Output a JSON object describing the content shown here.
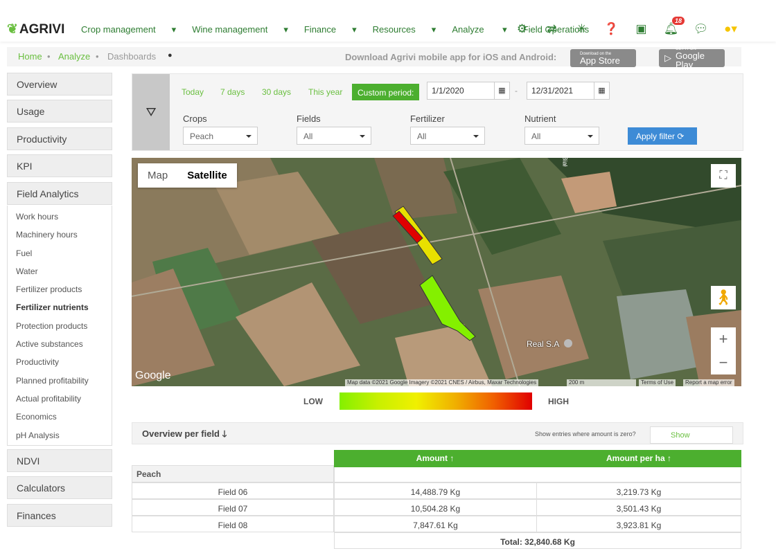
{
  "nav": {
    "brand": "AGRIVI",
    "menu": [
      "Crop management",
      "Wine management",
      "Finance",
      "Resources",
      "Analyze",
      "Field Operations"
    ],
    "notification_count": "18",
    "icons": [
      "gear-icon",
      "transfer-icon",
      "network-icon",
      "help-icon",
      "calendar-icon",
      "bell-icon",
      "chat-icon",
      "user-logo-icon"
    ]
  },
  "breadcrumb": {
    "items": [
      "Home",
      "Analyze",
      "Dashboards"
    ],
    "download_text": "Download Agrivi mobile app for iOS and Android:",
    "app_store": "App Store",
    "app_store_small": "Download on the",
    "google_play": "Google Play",
    "google_play_small": "GET IT ON"
  },
  "sidebar": {
    "sections": [
      "Overview",
      "Usage",
      "Productivity",
      "KPI",
      "Field Analytics"
    ],
    "sub_items": [
      "Work hours",
      "Machinery hours",
      "Fuel",
      "Water",
      "Fertilizer products",
      "Fertilizer nutrients",
      "Protection products",
      "Active substances",
      "Productivity",
      "Planned profitability",
      "Actual profitability",
      "Economics",
      "pH Analysis"
    ],
    "active_sub": "Fertilizer nutrients",
    "bottom": [
      "NDVI",
      "Calculators",
      "Finances"
    ]
  },
  "filter": {
    "periods": [
      "Today",
      "7 days",
      "30 days",
      "This year"
    ],
    "custom": "Custom period:",
    "date_from": "1/1/2020",
    "date_to": "12/31/2021",
    "date_sep": "-",
    "labels": [
      "Crops",
      "Fields",
      "Fertilizer",
      "Nutrient"
    ],
    "values": [
      "Peach",
      "All",
      "All",
      "All"
    ],
    "apply": "Apply filter"
  },
  "map": {
    "tabs": [
      "Map",
      "Satellite"
    ],
    "active_tab": "Satellite",
    "google": "Google",
    "place": "Real S.A",
    "road": "Biał",
    "attribution": "Map data ©2021 Google Imagery ©2021 CNES / Airbus, Maxar Technologies",
    "scale": "200 m",
    "terms": "Terms of Use",
    "report": "Report a map error",
    "zoom_in": "+",
    "zoom_out": "−"
  },
  "legend": {
    "low": "LOW",
    "high": "HIGH",
    "colors": [
      "#84f000",
      "#f0f000",
      "#e00000"
    ]
  },
  "overview": {
    "title": "Overview per field",
    "zero_question": "Show entries where amount is zero?",
    "show": "Show"
  },
  "table": {
    "headers": [
      "Amount",
      "Amount per ha"
    ],
    "group": "Peach",
    "rows": [
      {
        "field": "Field 06",
        "amount": "14,488.79 Kg",
        "per_ha": "3,219.73 Kg"
      },
      {
        "field": "Field 07",
        "amount": "10,504.28 Kg",
        "per_ha": "3,501.43 Kg"
      },
      {
        "field": "Field 08",
        "amount": "7,847.61 Kg",
        "per_ha": "3,923.81 Kg"
      }
    ],
    "total": "Total: 32,840.68 Kg"
  }
}
